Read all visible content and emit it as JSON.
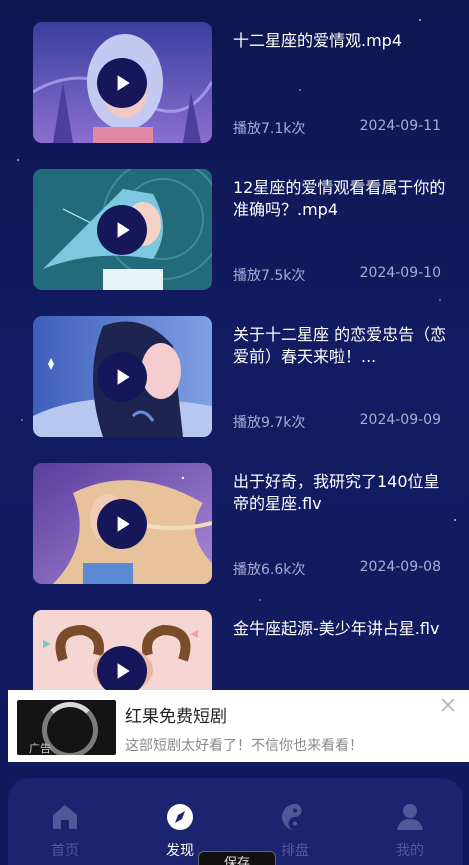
{
  "videos": [
    {
      "title": "十二星座的爱情观.mp4",
      "plays": "播放7.1k次",
      "date": "2024-09-11"
    },
    {
      "title": "12星座的爱情观看看属于你的准确吗？.mp4",
      "plays": "播放7.5k次",
      "date": "2024-09-10"
    },
    {
      "title": "关于十二星座 的恋爱忠告（恋爱前）春天来啦！...",
      "plays": "播放9.7k次",
      "date": "2024-09-09"
    },
    {
      "title": "出于好奇，我研究了140位皇帝的星座.flv",
      "plays": "播放6.6k次",
      "date": "2024-09-08"
    },
    {
      "title": "金牛座起源-美少年讲占星.flv",
      "plays": "",
      "date": ""
    }
  ],
  "ad": {
    "tag": "广告",
    "title": "红果免费短剧",
    "description": "这部短剧太好看了！不信你也来看看！"
  },
  "tabs": [
    {
      "label": "首页",
      "icon": "home-icon"
    },
    {
      "label": "发现",
      "icon": "compass-icon"
    },
    {
      "label": "排盘",
      "icon": "yin-yang-icon"
    },
    {
      "label": "我的",
      "icon": "user-icon"
    }
  ],
  "toast": "保存",
  "colors": {
    "background": "#131b62",
    "tabbar": "#1c2470",
    "play_button": "#15175a",
    "muted_text": "#a7acd4"
  }
}
